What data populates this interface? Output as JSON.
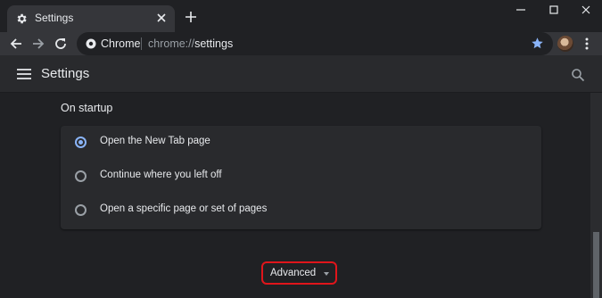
{
  "tab": {
    "title": "Settings",
    "icon": "gear-icon"
  },
  "window_controls": [
    "minimize-icon",
    "maximize-icon",
    "close-icon"
  ],
  "omnibox": {
    "site_name": "Chrome",
    "url_scheme": "chrome://",
    "url_host": "settings"
  },
  "settings": {
    "title": "Settings"
  },
  "startup": {
    "section_title": "On startup",
    "options": [
      {
        "label": "Open the New Tab page",
        "selected": true
      },
      {
        "label": "Continue where you left off",
        "selected": false
      },
      {
        "label": "Open a specific page or set of pages",
        "selected": false
      }
    ]
  },
  "advanced": {
    "label": "Advanced"
  },
  "colors": {
    "accent": "#8ab4f8",
    "highlight": "#e0151b",
    "background": "#202124"
  }
}
